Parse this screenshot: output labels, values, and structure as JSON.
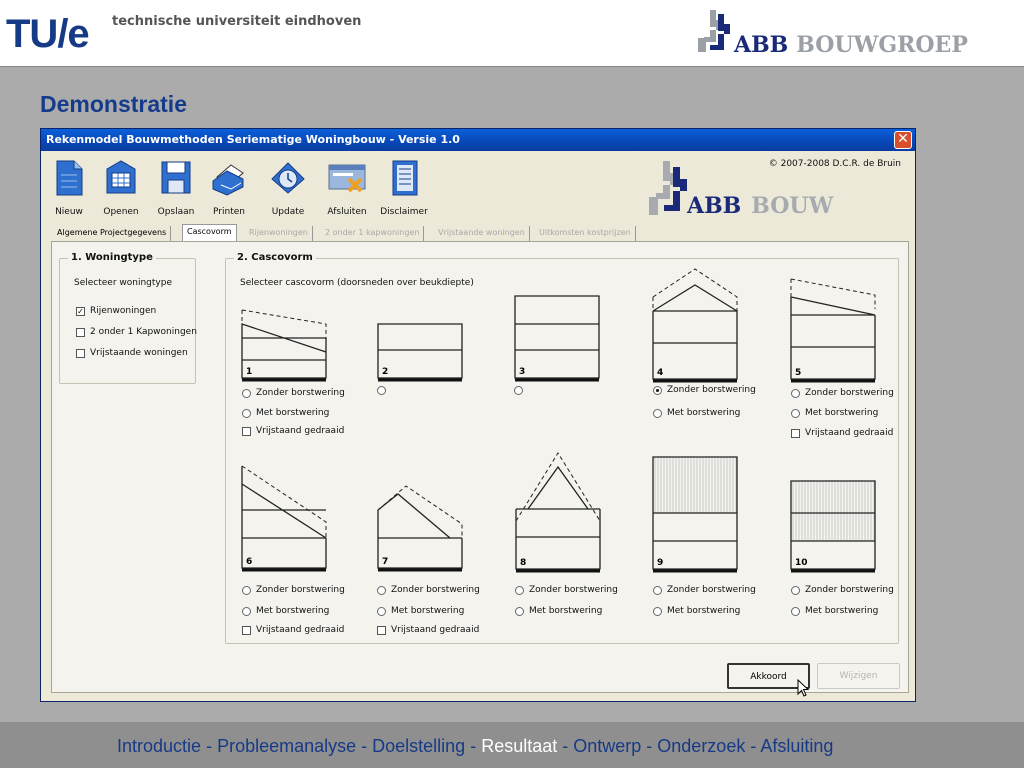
{
  "slide": {
    "university_logo": "TU/e",
    "university_name": "technische universiteit eindhoven",
    "company_logo_main": "ABB",
    "company_logo_sub": "BOUWGROEP",
    "title": "Demonstratie"
  },
  "window": {
    "title": "Rekenmodel Bouwmethoden Seriematige Woningbouw  -  Versie 1.0",
    "close_icon": "close-icon",
    "copyright": "© 2007-2008 D.C.R. de Bruin",
    "logo_main": "ABB",
    "logo_sub": "BOUW"
  },
  "toolbar": [
    {
      "label": "Nieuw",
      "icon": "new-document-icon"
    },
    {
      "label": "Openen",
      "icon": "open-folder-icon"
    },
    {
      "label": "Opslaan",
      "icon": "floppy-disk-icon"
    },
    {
      "label": "Printen",
      "icon": "printer-icon"
    },
    {
      "label": "Update",
      "icon": "clock-update-icon"
    },
    {
      "label": "Afsluiten",
      "icon": "exit-icon"
    },
    {
      "label": "Disclaimer",
      "icon": "text-document-icon"
    }
  ],
  "tabs": [
    {
      "label": "Algemene Projectgegevens",
      "state": "normal"
    },
    {
      "label": "Cascovorm",
      "state": "active"
    },
    {
      "label": "Rijenwoningen",
      "state": "disabled"
    },
    {
      "label": "2 onder 1 kapwoningen",
      "state": "disabled"
    },
    {
      "label": "Vrijstaande woningen",
      "state": "disabled"
    },
    {
      "label": "Uitkomsten kostprijzen",
      "state": "disabled"
    }
  ],
  "woningtype": {
    "title": "1. Woningtype",
    "prompt": "Selecteer woningtype",
    "options": [
      {
        "label": "Rijenwoningen",
        "checked": true
      },
      {
        "label": "2 onder 1 Kapwoningen",
        "checked": false
      },
      {
        "label": "Vrijstaande woningen",
        "checked": false
      }
    ]
  },
  "cascovorm": {
    "title": "2. Cascovorm",
    "prompt": "Selecteer cascovorm (doorsneden over beukdiepte)",
    "option_zonder": "Zonder borstwering",
    "option_met": "Met borstwering",
    "option_vrijstaand": "Vrijstaand gedraaid",
    "check_mark": "✓",
    "shapes": [
      {
        "number": "1",
        "roof": "mono-pitch",
        "options": [
          "zonder",
          "met",
          "vrijstaand"
        ],
        "selected": "none"
      },
      {
        "number": "2",
        "roof": "flat",
        "options": [
          "blank"
        ],
        "selected": "none"
      },
      {
        "number": "3",
        "roof": "flat-three-storey",
        "options": [
          "blank"
        ],
        "selected": "none"
      },
      {
        "number": "4",
        "roof": "pitched",
        "options": [
          "zonder",
          "met"
        ],
        "selected": "zonder"
      },
      {
        "number": "5",
        "roof": "mono-pitch",
        "options": [
          "zonder",
          "met",
          "vrijstaand"
        ],
        "selected": "none"
      },
      {
        "number": "6",
        "roof": "steep-mono-pitch",
        "options": [
          "zonder",
          "met",
          "vrijstaand"
        ],
        "selected": "none"
      },
      {
        "number": "7",
        "roof": "low-pitched",
        "options": [
          "zonder",
          "met",
          "vrijstaand"
        ],
        "selected": "none"
      },
      {
        "number": "8",
        "roof": "steep-pitched",
        "options": [
          "zonder",
          "met"
        ],
        "selected": "none"
      },
      {
        "number": "9",
        "roof": "flat-hatched-three-storey",
        "options": [
          "zonder",
          "met"
        ],
        "selected": "none"
      },
      {
        "number": "10",
        "roof": "flat-hatched",
        "options": [
          "zonder",
          "met"
        ],
        "selected": "none"
      }
    ]
  },
  "buttons": {
    "akkoord": "Akkoord",
    "wijzigen": "Wijzigen"
  },
  "nav": {
    "items": [
      "Introductie",
      "Probleemanalyse",
      "Doelstelling",
      "Resultaat",
      "Ontwerp",
      "Onderzoek",
      "Afsluiting"
    ],
    "separator": " - ",
    "current": "Resultaat"
  }
}
